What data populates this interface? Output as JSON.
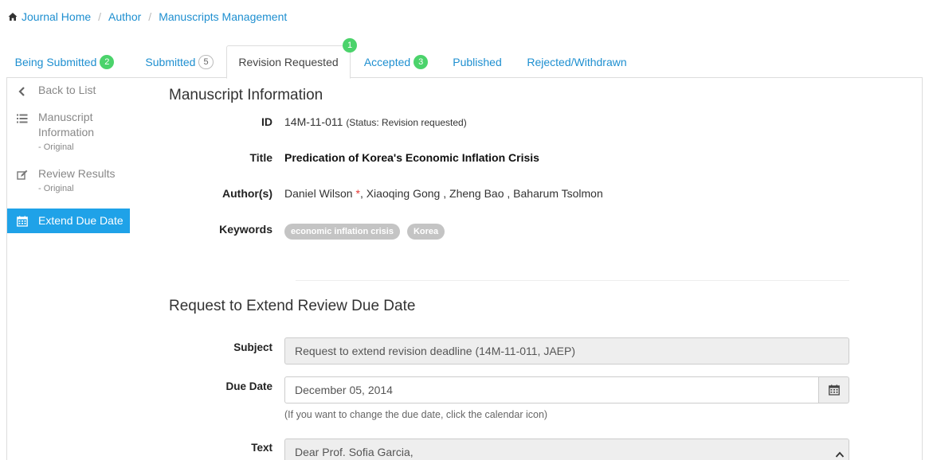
{
  "breadcrumb": {
    "home_icon": "home-icon",
    "home": "Journal Home",
    "author": "Author",
    "current": "Manuscripts Management"
  },
  "tabs": {
    "being_submitted": {
      "label": "Being Submitted",
      "count": "2"
    },
    "submitted": {
      "label": "Submitted",
      "count": "5"
    },
    "revision_requested": {
      "label": "Revision Requested",
      "count": "1"
    },
    "accepted": {
      "label": "Accepted",
      "count": "3"
    },
    "published": {
      "label": "Published"
    },
    "rejected": {
      "label": "Rejected/Withdrawn"
    }
  },
  "sidebar": {
    "back": {
      "label": "Back to List",
      "icon": "chevron-left-icon"
    },
    "manuscript": {
      "label": "Manuscript Information",
      "sub": "- Original",
      "icon": "list-icon"
    },
    "review": {
      "label": "Review Results",
      "sub": "- Original",
      "icon": "edit-icon"
    },
    "extend": {
      "label": "Extend Due Date",
      "icon": "calendar-icon"
    }
  },
  "manuscript": {
    "heading": "Manuscript Information",
    "id_label": "ID",
    "id_value": "14M-11-011",
    "status": "(Status: Revision requested)",
    "title_label": "Title",
    "title_value": "Predication of Korea's Economic Inflation Crisis",
    "authors_label": "Author(s)",
    "author_first": "Daniel Wilson",
    "author_required_mark": "*",
    "authors_rest": ", Xiaoqing Gong , Zheng Bao , Baharum Tsolmon",
    "keywords_label": "Keywords",
    "keywords": [
      "economic inflation crisis",
      "Korea"
    ]
  },
  "extend_form": {
    "heading": "Request to Extend Review Due Date",
    "subject_label": "Subject",
    "subject_value": "Request to extend revision deadline (14M-11-011, JAEP)",
    "due_date_label": "Due Date",
    "due_date_value": "December 05, 2014",
    "due_date_help": "(If you want to change the due date, click the calendar icon)",
    "text_label": "Text",
    "text_value": "Dear Prof. Sofia Garcia,"
  },
  "colors": {
    "link": "#1e8fd0",
    "badge": "#4bd36b",
    "active_sidebar": "#1fa2e8",
    "required": "#e53935"
  }
}
